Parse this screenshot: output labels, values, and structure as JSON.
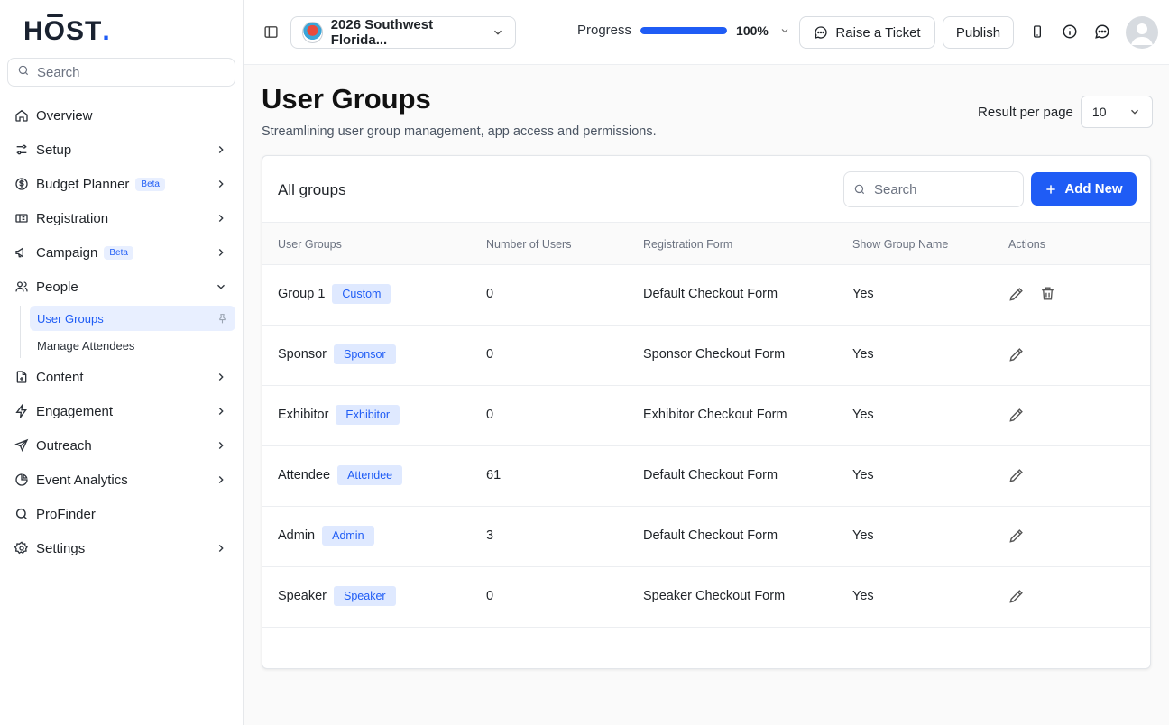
{
  "brand": {
    "logo_text": "HŌST."
  },
  "sidebar": {
    "search_placeholder": "Search",
    "items": [
      {
        "label": "Overview",
        "icon": "home-icon"
      },
      {
        "label": "Setup",
        "icon": "sliders-icon"
      },
      {
        "label": "Budget Planner",
        "icon": "dollar-circle-icon",
        "badge": "Beta"
      },
      {
        "label": "Registration",
        "icon": "ticket-icon"
      },
      {
        "label": "Campaign",
        "icon": "megaphone-icon",
        "badge": "Beta"
      },
      {
        "label": "People",
        "icon": "users-icon"
      },
      {
        "label": "Content",
        "icon": "file-plus-icon"
      },
      {
        "label": "Engagement",
        "icon": "zap-icon"
      },
      {
        "label": "Outreach",
        "icon": "send-icon"
      },
      {
        "label": "Event Analytics",
        "icon": "pie-chart-icon"
      },
      {
        "label": "ProFinder",
        "icon": "search-icon"
      },
      {
        "label": "Settings",
        "icon": "gear-icon"
      }
    ],
    "people_sub": [
      {
        "label": "User Groups",
        "active": true
      },
      {
        "label": "Manage Attendees",
        "active": false
      }
    ]
  },
  "topbar": {
    "event_name": "2026 Southwest Florida...",
    "progress_label": "Progress",
    "progress_value": "100%",
    "progress_fraction": 1.0,
    "raise_ticket": "Raise a Ticket",
    "publish": "Publish"
  },
  "page": {
    "title": "User Groups",
    "subtitle": "Streamlining user group management, app access and permissions.",
    "result_per_page_label": "Result per page",
    "result_per_page_value": "10"
  },
  "card": {
    "title": "All groups",
    "search_placeholder": "Search",
    "add_new": "Add New",
    "columns": [
      "User Groups",
      "Number of Users",
      "Registration Form",
      "Show Group Name",
      "Actions"
    ],
    "rows": [
      {
        "name": "Group 1",
        "tag": "Custom",
        "users": "0",
        "form": "Default Checkout Form",
        "show": "Yes",
        "deletable": true
      },
      {
        "name": "Sponsor",
        "tag": "Sponsor",
        "users": "0",
        "form": "Sponsor Checkout Form",
        "show": "Yes",
        "deletable": false
      },
      {
        "name": "Exhibitor",
        "tag": "Exhibitor",
        "users": "0",
        "form": "Exhibitor Checkout Form",
        "show": "Yes",
        "deletable": false
      },
      {
        "name": "Attendee",
        "tag": "Attendee",
        "users": "61",
        "form": "Default Checkout Form",
        "show": "Yes",
        "deletable": false
      },
      {
        "name": "Admin",
        "tag": "Admin",
        "users": "3",
        "form": "Default Checkout Form",
        "show": "Yes",
        "deletable": false
      },
      {
        "name": "Speaker",
        "tag": "Speaker",
        "users": "0",
        "form": "Speaker Checkout Form",
        "show": "Yes",
        "deletable": false
      }
    ]
  },
  "colors": {
    "accent": "#1f5cf5",
    "tag_bg": "#dfe9ff"
  }
}
